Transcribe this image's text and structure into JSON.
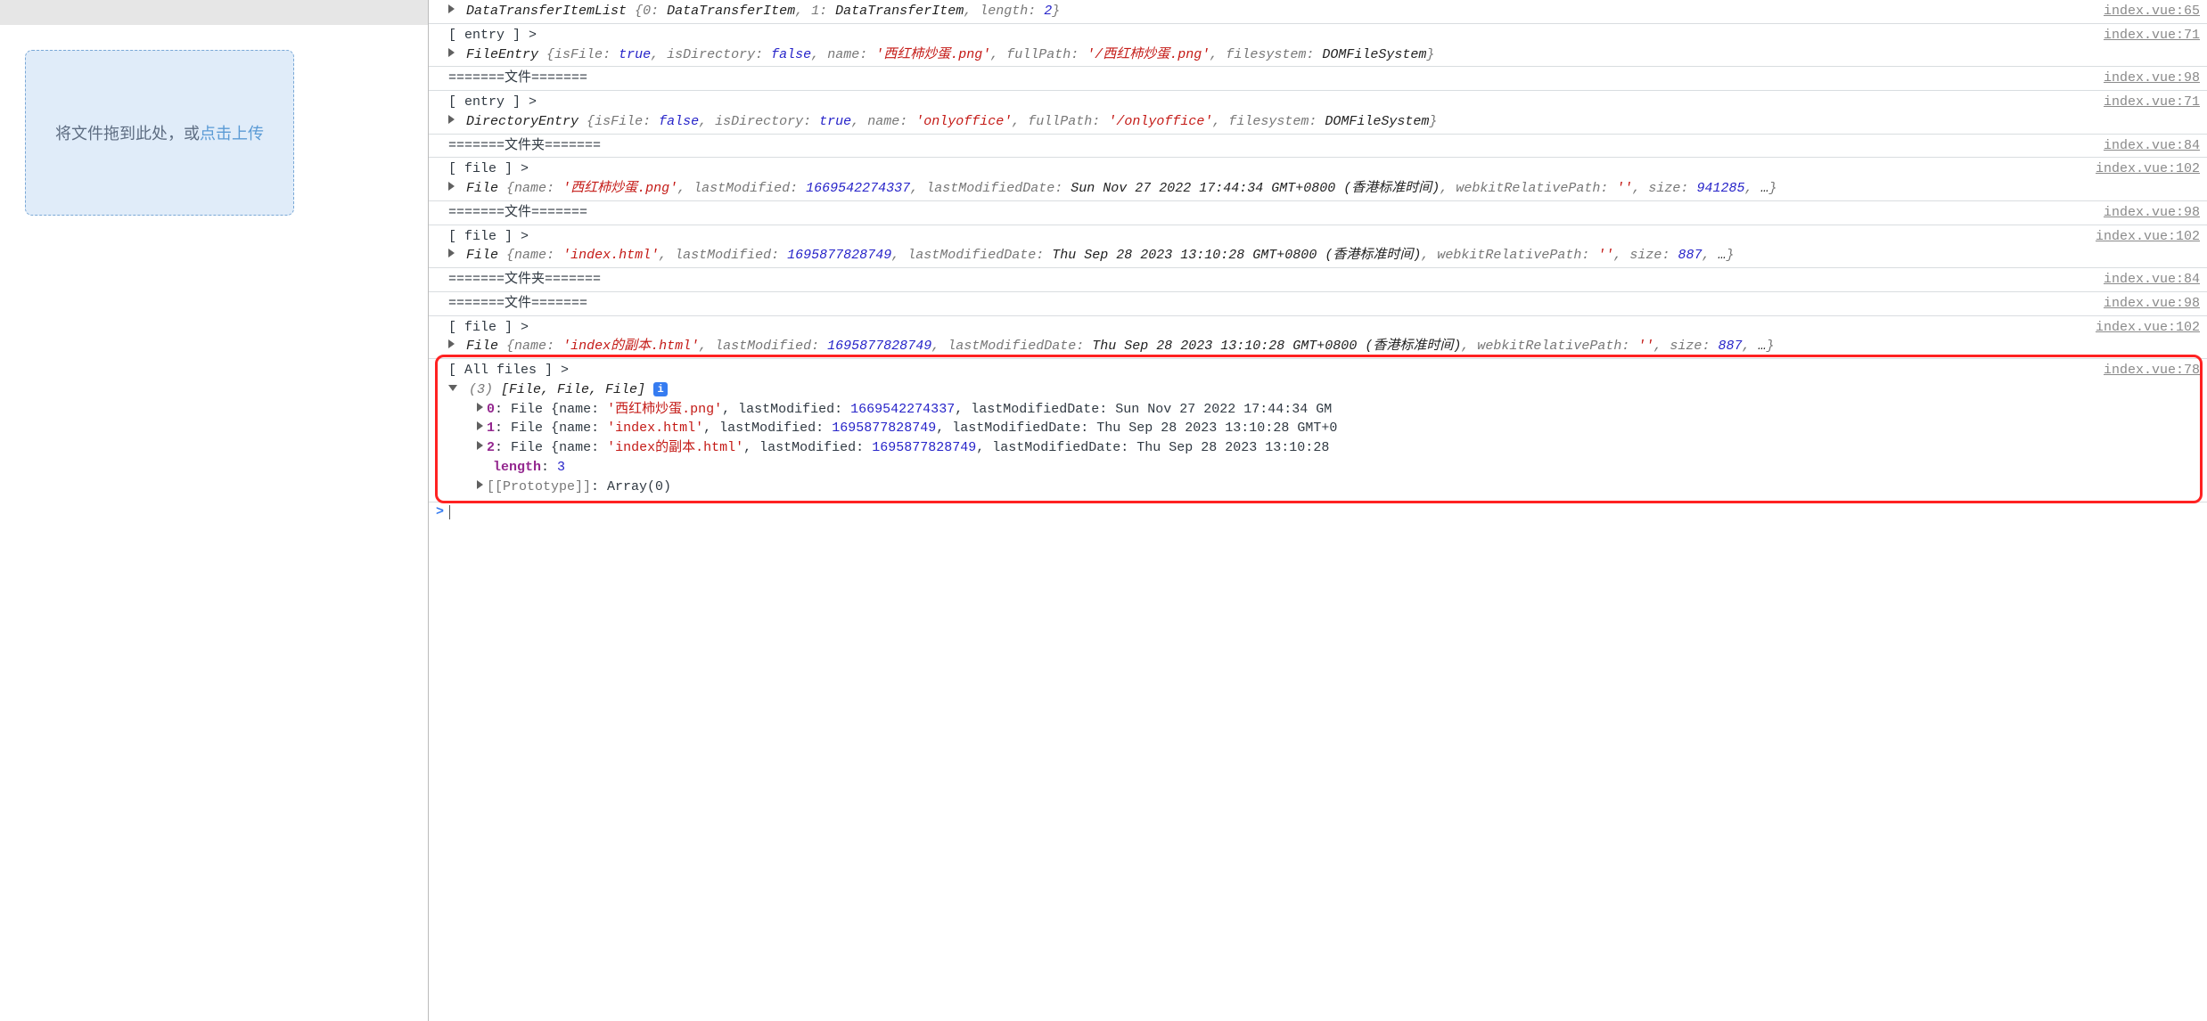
{
  "upload": {
    "drag_text": "将文件拖到此处，或",
    "click_text": "点击上传"
  },
  "src": {
    "l65": "index.vue:65",
    "l71": "index.vue:71",
    "l98": "index.vue:98",
    "l84": "index.vue:84",
    "l102": "index.vue:102",
    "l78": "index.vue:78"
  },
  "labels": {
    "entry": "[ entry ] >",
    "file": "[ file ] >",
    "allfiles": "[ All files ] >",
    "sep_file": "=======文件=======",
    "sep_dir": "=======文件夹=======",
    "length": "length",
    "proto": "[[Prototype]]",
    "array0": "Array(0)",
    "info": "i"
  },
  "row1": {
    "class": "DataTransferItemList ",
    "k0": "0",
    "v0": "DataTransferItem",
    "k1": "1",
    "v1": "DataTransferItem",
    "klen": "length",
    "vlen": "2"
  },
  "row2": {
    "class": "FileEntry ",
    "k_isFile": "isFile",
    "v_isFile": "true",
    "k_isDir": "isDirectory",
    "v_isDir": "false",
    "k_name": "name",
    "v_name": "'西红柿炒蛋.png'",
    "k_fp": "fullPath",
    "v_fp": "'/西红柿炒蛋.png'",
    "k_fs": "filesystem",
    "v_fs": "DOMFileSystem"
  },
  "row_dir": {
    "class": "DirectoryEntry ",
    "k_isFile": "isFile",
    "v_isFile": "false",
    "k_isDir": "isDirectory",
    "v_isDir": "true",
    "k_name": "name",
    "v_name": "'onlyoffice'",
    "k_fp": "fullPath",
    "v_fp": "'/onlyoffice'",
    "k_fs": "filesystem",
    "v_fs": "DOMFileSystem"
  },
  "fileA": {
    "class": "File ",
    "k_name": "name",
    "v_name": "'西红柿炒蛋.png'",
    "k_lm": "lastModified",
    "v_lm": "1669542274337",
    "k_lmd": "lastModifiedDate",
    "v_lmd": "Sun Nov 27 2022 17:44:34 GMT+0800 (香港标准时间)",
    "k_wrp": "webkitRelativePath",
    "v_wrp": "''",
    "k_size": "size",
    "v_size": "941285",
    "more": "…"
  },
  "fileB": {
    "class": "File ",
    "k_name": "name",
    "v_name": "'index.html'",
    "k_lm": "lastModified",
    "v_lm": "1695877828749",
    "k_lmd": "lastModifiedDate",
    "v_lmd": "Thu Sep 28 2023 13:10:28 GMT+0800 (香港标准时间)",
    "k_wrp": "webkitRelativePath",
    "v_wrp": "''",
    "k_size": "size",
    "v_size": "887",
    "more": "…"
  },
  "fileC": {
    "class": "File ",
    "k_name": "name",
    "v_name": "'index的副本.html'",
    "k_lm": "lastModified",
    "v_lm": "1695877828749",
    "k_lmd": "lastModifiedDate",
    "v_lmd": "Thu Sep 28 2023 13:10:28 GMT+0800 (香港标准时间)",
    "k_wrp": "webkitRelativePath",
    "v_wrp": "''",
    "k_size": "size",
    "v_size": "887",
    "more": "…"
  },
  "allfiles": {
    "header_count": "(3) ",
    "header_types": "[File, File, File]",
    "len_val": "3",
    "items": [
      {
        "idx": "0",
        "class": "File ",
        "v_name": "'西红柿炒蛋.png'",
        "v_lm": "1669542274337",
        "v_lmd": "Sun Nov 27 2022 17:44:34 GM"
      },
      {
        "idx": "1",
        "class": "File ",
        "v_name": "'index.html'",
        "v_lm": "1695877828749",
        "v_lmd": "Thu Sep 28 2023 13:10:28 GMT+0"
      },
      {
        "idx": "2",
        "class": "File ",
        "v_name": "'index的副本.html'",
        "v_lm": "1695877828749",
        "v_lmd": "Thu Sep 28 2023 13:10:28"
      }
    ],
    "k_name": "name",
    "k_lm": "lastModified",
    "k_lmd": "lastModifiedDate"
  }
}
